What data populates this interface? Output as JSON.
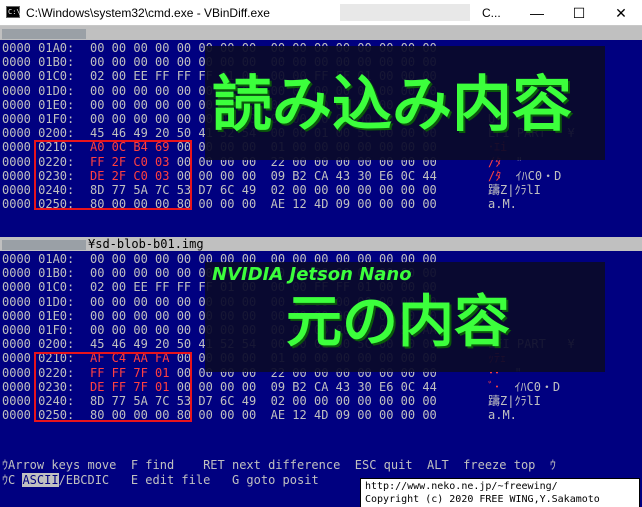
{
  "window": {
    "title": "C:\\Windows\\system32\\cmd.exe - VBinDiff.exe",
    "title_tail": "C...",
    "controls": {
      "minimize": "—",
      "maximize": "☐",
      "close": "✕"
    }
  },
  "top_panel": {
    "file_label": "",
    "rows": [
      {
        "offset": "0000 01A0:",
        "hex": "00 00 00 00 00 00 00 00  00 00 00 00 00 00 00 00",
        "ascii": ""
      },
      {
        "offset": "0000 01B0:",
        "hex": "00 00 00 00 00 00 00 00  00 00 00 00 00 00 00 00",
        "ascii": ""
      },
      {
        "offset": "0000 01C0:",
        "hex": "02 00 EE FF FF FF 01 00  00 00 FF FF 01 00 00 00",
        "ascii": ""
      },
      {
        "offset": "0000 01D0:",
        "hex": "00 00 00 00 00 00 00 00  00 00 00 00 00 00 00 00",
        "ascii": ""
      },
      {
        "offset": "0000 01E0:",
        "hex": "00 00 00 00 00 00 00 00  00 00 00 00 00 00 00 00",
        "ascii": ""
      },
      {
        "offset": "0000 01F0:",
        "hex": "00 00 00 00 00 00 00 00  00 00 00 00 00 00 55 AA",
        "ascii": "Uェ"
      },
      {
        "offset": "0000 0200:",
        "hex": "45 46 49 20 50 41 52 54  00 00 01 00 5C 00 00 00",
        "ascii": "EFI PART   ¥"
      },
      {
        "offset": "0000 0210:",
        "hex": "00 00 00 00 00 00 00 00  01 00 00 00 00 00 00 00",
        "ascii": ""
      },
      {
        "offset": "0000 0220:",
        "hex": "00 00 00 00 00 00 00 00  22 00 00 00 00 00 00 00",
        "ascii": "\""
      },
      {
        "offset": "0000 0230:",
        "hex": "00 00 00 00 00 00 00 00  09 B2 CA 43 30 E6 0C 44",
        "ascii": "ｲﾊC0・D"
      },
      {
        "offset": "0000 0240:",
        "hex": "8D 77 5A 7C 53 D7 6C 49  02 00 00 00 00 00 00 00",
        "ascii": "躊Z|ｸﾗlI"
      },
      {
        "offset": "0000 0250:",
        "hex": "80 00 00 00 80 00 00 00  AE 12 4D 09 00 00 00 00",
        "ascii": "a.M."
      }
    ],
    "highlight_hex": [
      "A0 0C B4 69",
      "FF 2F C0 03",
      "DE 2F C0 03"
    ],
    "highlight_ascii": [
      "･ｴi",
      "/ﾀ",
      "/ﾀ"
    ],
    "overlay_title": "読み込み内容"
  },
  "bottom_panel": {
    "file_label": "¥sd-blob-b01.img",
    "rows": [
      {
        "offset": "0000 01A0:",
        "hex": "00 00 00 00 00 00 00 00  00 00 00 00 00 00 00 00",
        "ascii": ""
      },
      {
        "offset": "0000 01B0:",
        "hex": "00 00 00 00 00 00 00 00  00 00 00 00 00 00 00 00",
        "ascii": ""
      },
      {
        "offset": "0000 01C0:",
        "hex": "02 00 EE FF FF FF 01 00  00 00 FF FF 01 00 00 00",
        "ascii": ""
      },
      {
        "offset": "0000 01D0:",
        "hex": "00 00 00 00 00 00 00 00  00 00 00 00 00 00 00 00",
        "ascii": ""
      },
      {
        "offset": "0000 01E0:",
        "hex": "00 00 00 00 00 00 00 00  00 00 00 00 00 00 00 00",
        "ascii": ""
      },
      {
        "offset": "0000 01F0:",
        "hex": "00 00 00 00 00 00 00 00  00 00 00 00 00 00 55 AA",
        "ascii": "Uェ"
      },
      {
        "offset": "0000 0200:",
        "hex": "45 46 49 20 50 41 52 54  00 00 01 00 5C 00 00 00",
        "ascii": "EFI PART   ¥"
      },
      {
        "offset": "0000 0210:",
        "hex": "00 00 00 00 00 00 00 00  01 00 00 00 00 00 00 00",
        "ascii": ""
      },
      {
        "offset": "0000 0220:",
        "hex": "00 00 00 00 00 00 00 00  22 00 00 00 00 00 00 00",
        "ascii": "\""
      },
      {
        "offset": "0000 0230:",
        "hex": "00 00 00 00 00 00 00 00  09 B2 CA 43 30 E6 0C 44",
        "ascii": "ｲﾊC0・D"
      },
      {
        "offset": "0000 0240:",
        "hex": "8D 77 5A 7C 53 D7 6C 49  02 00 00 00 00 00 00 00",
        "ascii": "躊Z|ｸﾗlI"
      },
      {
        "offset": "0000 0250:",
        "hex": "80 00 00 00 80 00 00 00  AE 12 4D 09 00 00 00 00",
        "ascii": "a.M."
      }
    ],
    "highlight_hex": [
      "AF C4 AA FA",
      "FF FF 7F 01",
      "DE FF 7F 01"
    ],
    "highlight_ascii": [
      "ｯﾃｪ",
      "･･",
      "ﾞ･"
    ],
    "overlay_subtitle": "NVIDIA Jetson Nano",
    "overlay_title": "元の内容"
  },
  "help": {
    "line1": "ｳArrow keys move  F find    RET next difference  ESC quit  ALT  freeze top  ｳ",
    "line2_prefix": "ｳC ",
    "ascii_mode": "ASCII",
    "line2_rest": "/EBCDIC   E edit file   G goto posit"
  },
  "copyright": {
    "line1": "http://www.neko.ne.jp/~freewing/",
    "line2": "Copyright (c) 2020 FREE WING,Y.Sakamoto"
  }
}
